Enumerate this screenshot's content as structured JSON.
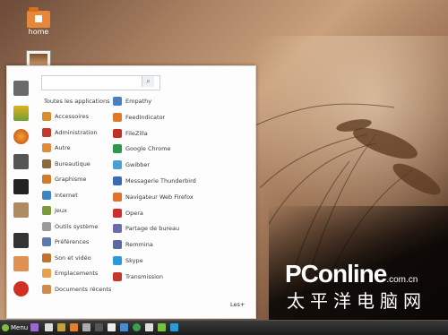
{
  "desktop": {
    "icons": [
      {
        "label": "home"
      }
    ]
  },
  "menu": {
    "search": {
      "value": "",
      "placeholder": ""
    },
    "all_label": "Toutes les applications",
    "categories": [
      {
        "label": "Accessoires",
        "color": "#d98c2b"
      },
      {
        "label": "Administration",
        "color": "#c0392b"
      },
      {
        "label": "Autre",
        "color": "#e08a3a"
      },
      {
        "label": "Bureautique",
        "color": "#8a6a3a"
      },
      {
        "label": "Graphisme",
        "color": "#d07a2a"
      },
      {
        "label": "Internet",
        "color": "#3a86c8"
      },
      {
        "label": "Jeux",
        "color": "#7a9a3a"
      },
      {
        "label": "Outils système",
        "color": "#999999"
      },
      {
        "label": "Préférences",
        "color": "#5a7ab0"
      },
      {
        "label": "Son et vidéo",
        "color": "#c07030"
      },
      {
        "label": "Emplacements",
        "color": "#e8a050"
      },
      {
        "label": "Documents récents",
        "color": "#d08a4a"
      }
    ],
    "apps": [
      {
        "label": "Empathy",
        "color": "#4a80c0"
      },
      {
        "label": "FeedIndicator",
        "color": "#e07a2a"
      },
      {
        "label": "FileZilla",
        "color": "#c0302a"
      },
      {
        "label": "Google Chrome",
        "color": "#2a9a4a"
      },
      {
        "label": "Gwibber",
        "color": "#4aa0d0"
      },
      {
        "label": "Messagerie Thunderbird",
        "color": "#3a6ab0"
      },
      {
        "label": "Navigateur Web Firefox",
        "color": "#e0702a"
      },
      {
        "label": "Opera",
        "color": "#d02a2a"
      },
      {
        "label": "Partage de bureau",
        "color": "#6a6ab0"
      },
      {
        "label": "Remmina",
        "color": "#5a6aa0"
      },
      {
        "label": "Skype",
        "color": "#2a9ad8"
      },
      {
        "label": "Transmission",
        "color": "#c03a2a"
      }
    ],
    "more_label": "Les+"
  },
  "taskbar": {
    "menu_label": "Menu"
  },
  "watermark": {
    "brand": "PConline",
    "domain": ".com.cn",
    "chinese": "太平洋电脑网"
  }
}
